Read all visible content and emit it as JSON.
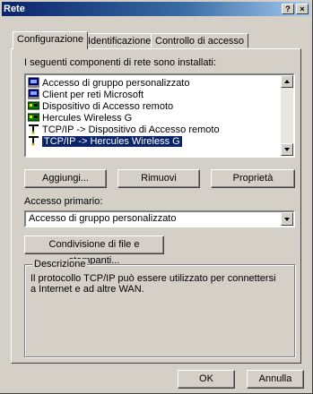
{
  "window": {
    "title": "Rete"
  },
  "titlebar_buttons": {
    "help": "?",
    "close": "×"
  },
  "tabs": [
    {
      "label": "Configurazione",
      "active": true
    },
    {
      "label": "Identificazione",
      "active": false
    },
    {
      "label": "Controllo di accesso",
      "active": false
    }
  ],
  "components_label": "I seguenti componenti di rete sono installati:",
  "components": [
    {
      "label": "Accesso di gruppo personalizzato",
      "icon": "client-icon",
      "selected": false
    },
    {
      "label": "Client per reti Microsoft",
      "icon": "client-icon",
      "selected": false
    },
    {
      "label": "Dispositivo di Accesso remoto",
      "icon": "adapter-icon",
      "selected": false
    },
    {
      "label": "Hercules Wireless G",
      "icon": "adapter-icon",
      "selected": false
    },
    {
      "label": "TCP/IP -> Dispositivo di Accesso remoto",
      "icon": "protocol-icon",
      "selected": false
    },
    {
      "label": "TCP/IP -> Hercules Wireless G",
      "icon": "protocol-icon",
      "selected": true
    }
  ],
  "buttons": {
    "add": "Aggiungi...",
    "remove": "Rimuovi",
    "properties": "Proprietà"
  },
  "primary_access": {
    "label": "Accesso primario:",
    "value": "Accesso di gruppo personalizzato"
  },
  "sharing_button": "Condivisione di file e stampanti...",
  "description": {
    "legend": "Descrizione",
    "text": "Il protocollo TCP/IP può essere utilizzato per connettersi a Internet e ad altre WAN."
  },
  "footer": {
    "ok": "OK",
    "cancel": "Annulla"
  },
  "colors": {
    "titlebar_start": "#0a246a",
    "titlebar_end": "#a6caf0",
    "selection": "#0a246a",
    "face": "#d4d0c8"
  }
}
